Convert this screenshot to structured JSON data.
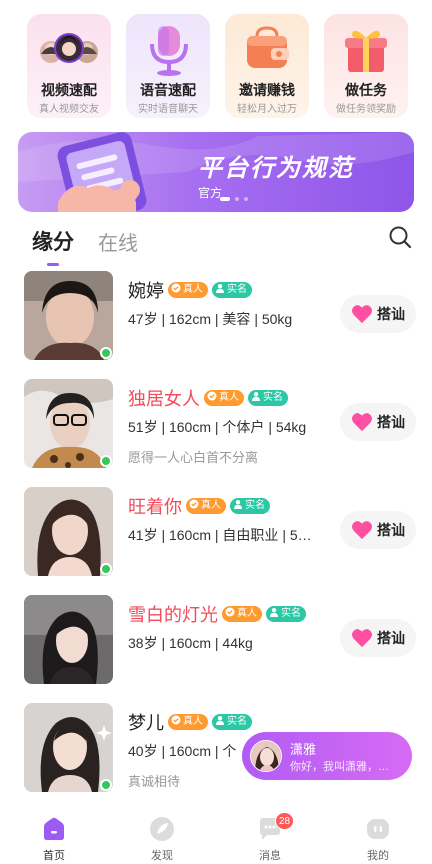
{
  "quick_actions": [
    {
      "title": "视频速配",
      "subtitle": "真人视频交友",
      "icon": "video-match-icon"
    },
    {
      "title": "语音速配",
      "subtitle": "实时语音聊天",
      "icon": "microphone-icon"
    },
    {
      "title": "邀请赚钱",
      "subtitle": "轻松月入过万",
      "icon": "wallet-icon"
    },
    {
      "title": "做任务",
      "subtitle": "做任务领奖励",
      "icon": "gift-box-icon"
    }
  ],
  "banner": {
    "title": "平台行为规范",
    "subtitle": "官方"
  },
  "tabs": [
    {
      "label": "缘分",
      "active": true
    },
    {
      "label": "在线",
      "active": false
    }
  ],
  "badges": {
    "real": "真人",
    "verified": "实名"
  },
  "greet_label": "搭讪",
  "users": [
    {
      "name": "婉婷",
      "name_color": "#222222",
      "info": "47岁 | 162cm | 美容 | 50kg",
      "signature": "",
      "online": true
    },
    {
      "name": "独居女人",
      "name_color": "#f24b5a",
      "info": "51岁 | 160cm | 个体户 | 54kg",
      "signature": "愿得一人心白首不分离",
      "online": true
    },
    {
      "name": "旺着你",
      "name_color": "#f24b5a",
      "info": "41岁 | 160cm | 自由职业 | 5…",
      "signature": "",
      "online": true
    },
    {
      "name": "雪白的灯光",
      "name_color": "#f24b5a",
      "info": "38岁 | 160cm | 44kg",
      "signature": "",
      "online": false
    },
    {
      "name": "梦儿",
      "name_color": "#222222",
      "info": "40岁 | 160cm | 个",
      "signature": "真诚相待",
      "online": true
    }
  ],
  "floating_message": {
    "name": "潇雅",
    "text": "你好，我叫潇雅，…"
  },
  "bottom_nav": [
    {
      "label": "首页",
      "icon": "home-icon",
      "active": true
    },
    {
      "label": "发现",
      "icon": "discover-icon",
      "active": false
    },
    {
      "label": "消息",
      "icon": "message-icon",
      "active": false,
      "badge": "28"
    },
    {
      "label": "我的",
      "icon": "profile-icon",
      "active": false
    }
  ],
  "colors": {
    "accent": "#9c5cf3",
    "online": "#34c759",
    "real_badge": "#ff9a2e",
    "verified_badge": "#2cc7a4",
    "heart": "#ff4fa0"
  }
}
